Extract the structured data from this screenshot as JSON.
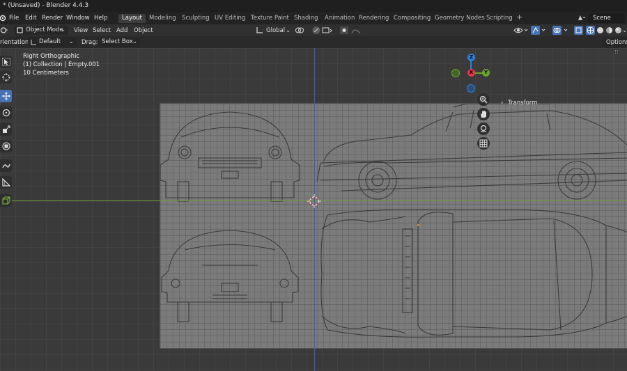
{
  "window": {
    "title": "* (Unsaved) - Blender 4.4.3"
  },
  "menu": [
    "File",
    "Edit",
    "Render",
    "Window",
    "Help"
  ],
  "workspaces": [
    "Layout",
    "Modeling",
    "Sculpting",
    "UV Editing",
    "Texture Paint",
    "Shading",
    "Animation",
    "Rendering",
    "Compositing",
    "Geometry Nodes",
    "Scripting"
  ],
  "active_workspace": "Layout",
  "add_workspace": "+",
  "scene": {
    "label": "Scene"
  },
  "header": {
    "mode": "Object Mode",
    "view": "View",
    "select": "Select",
    "add": "Add",
    "object": "Object",
    "orientation": "Global"
  },
  "tool_settings": {
    "orientation_label": "rientation:",
    "orientation_value": "Default",
    "drag_label": "Drag:",
    "drag_value": "Select Box",
    "options": "Options"
  },
  "viewport_info": {
    "view_name": "Right Orthographic",
    "collection": "(1) Collection | Empty.001",
    "scale": "10 Centimeters"
  },
  "gizmo": {
    "z": "Z",
    "x": "X",
    "y": "Y"
  },
  "sidebar": {
    "transform": "Transform"
  },
  "colors": {
    "accent": "#4772b3",
    "x_axis": "#e8344a",
    "y_axis": "#6aa52a",
    "z_axis": "#2f7fd9"
  }
}
